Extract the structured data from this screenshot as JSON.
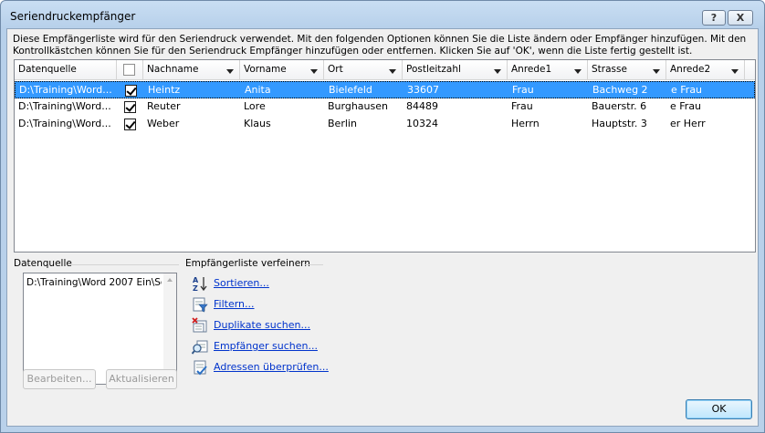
{
  "window": {
    "title": "Seriendruckempfänger",
    "help_label": "?",
    "close_label": "X"
  },
  "intro_text": "Diese Empfängerliste wird für den Seriendruck verwendet. Mit den folgenden Optionen können Sie die Liste ändern oder Empfänger hinzufügen. Mit den Kontrollkästchen können Sie für den Seriendruck Empfänger hinzufügen oder entfernen. Klicken Sie auf 'OK', wenn die Liste fertig gestellt ist.",
  "table": {
    "columns": [
      "Datenquelle",
      "",
      "Nachname",
      "Vorname",
      "Ort",
      "Postleitzahl",
      "Anrede1",
      "Strasse",
      "Anrede2"
    ],
    "rows": [
      {
        "source": "D:\\Training\\Word...",
        "checked": true,
        "nachname": "Heintz",
        "vorname": "Anita",
        "ort": "Bielefeld",
        "plz": "33607",
        "anrede1": "Frau",
        "strasse": "Bachweg 2",
        "anrede2": "e Frau",
        "selected": true
      },
      {
        "source": "D:\\Training\\Word...",
        "checked": true,
        "nachname": "Reuter",
        "vorname": "Lore",
        "ort": "Burghausen",
        "plz": "84489",
        "anrede1": "Frau",
        "strasse": "Bauerstr. 6",
        "anrede2": "e Frau",
        "selected": false
      },
      {
        "source": "D:\\Training\\Word...",
        "checked": true,
        "nachname": "Weber",
        "vorname": "Klaus",
        "ort": "Berlin",
        "plz": "10324",
        "anrede1": "Herrn",
        "strasse": "Hauptstr. 3",
        "anrede2": "er Herr",
        "selected": false
      }
    ]
  },
  "datasource": {
    "label": "Datenquelle",
    "item": "D:\\Training\\Word 2007 Ein\\Sch",
    "edit_label": "Bearbeiten...",
    "refresh_label": "Aktualisieren"
  },
  "refine": {
    "label": "Empfängerliste verfeinern",
    "links": [
      {
        "icon": "sort-icon",
        "label": "Sortieren..."
      },
      {
        "icon": "filter-icon",
        "label": "Filtern..."
      },
      {
        "icon": "duplicates-icon",
        "label": "Duplikate suchen..."
      },
      {
        "icon": "find-recipient-icon",
        "label": "Empfänger suchen..."
      },
      {
        "icon": "validate-address-icon",
        "label": "Adressen überprüfen..."
      }
    ]
  },
  "ok_label": "OK",
  "colors": {
    "selection": "#3399ff",
    "link": "#0033cc",
    "title_gradient_top": "#c9def3"
  }
}
